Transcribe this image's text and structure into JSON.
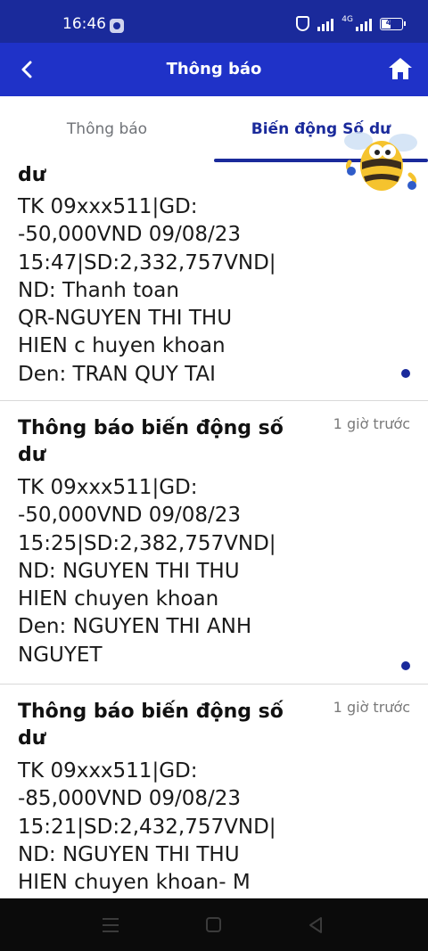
{
  "status_bar": {
    "time": "16:46",
    "network_label": "4G",
    "battery_level": "40"
  },
  "header": {
    "title": "Thông báo",
    "back_icon": "back-arrow-icon",
    "home_icon": "home-icon"
  },
  "tabs": [
    {
      "label": "Thông báo",
      "active": false
    },
    {
      "label": "Biến động Số dư",
      "active": true
    }
  ],
  "notifications": [
    {
      "title": "dư",
      "time": "",
      "body": "TK 09xxx511|GD:\n-50,000VND 09/08/23\n15:47|SD:2,332,757VND|\nND: Thanh toan\nQR-NGUYEN THI THU\nHIEN c huyen khoan\nDen: TRAN QUY TAI",
      "unread": true
    },
    {
      "title": "Thông báo biến động số dư",
      "time": "1 giờ trước",
      "body": "TK 09xxx511|GD:\n-50,000VND 09/08/23\n15:25|SD:2,382,757VND|\nND: NGUYEN THI THU\nHIEN chuyen khoan\nDen: NGUYEN THI ANH\nNGUYET",
      "unread": true
    },
    {
      "title": "Thông báo biến động số dư",
      "time": "1 giờ trước",
      "body": "TK 09xxx511|GD:\n-85,000VND 09/08/23\n15:21|SD:2,432,757VND|\nND: NGUYEN THI THU\nHIEN chuyen khoan- M",
      "unread": false
    }
  ],
  "colors": {
    "header_blue": "#1f32c8",
    "status_blue": "#1a2a9b",
    "unread_dot": "#1a2a9b"
  }
}
